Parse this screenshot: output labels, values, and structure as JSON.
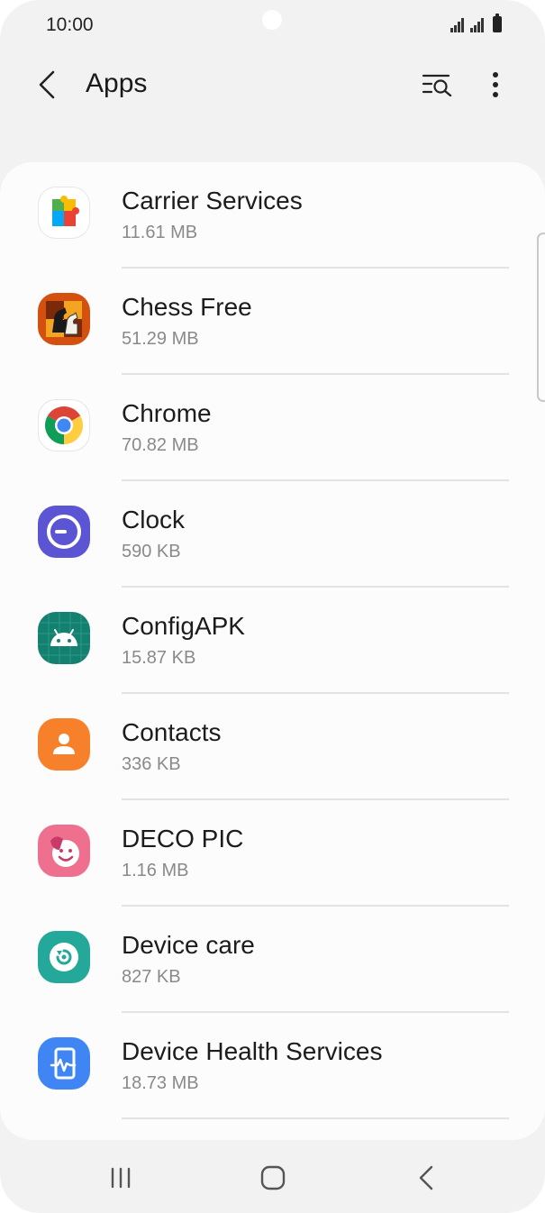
{
  "status_bar": {
    "time": "10:00"
  },
  "header": {
    "title": "Apps"
  },
  "apps": [
    {
      "name": "Carrier Services",
      "size": "11.61 MB",
      "icon": "carrier-services-icon"
    },
    {
      "name": "Chess Free",
      "size": "51.29 MB",
      "icon": "chess-free-icon"
    },
    {
      "name": "Chrome",
      "size": "70.82 MB",
      "icon": "chrome-icon"
    },
    {
      "name": "Clock",
      "size": "590 KB",
      "icon": "clock-icon"
    },
    {
      "name": "ConfigAPK",
      "size": "15.87 KB",
      "icon": "android-icon"
    },
    {
      "name": "Contacts",
      "size": "336 KB",
      "icon": "contacts-icon"
    },
    {
      "name": "DECO PIC",
      "size": "1.16 MB",
      "icon": "deco-pic-icon"
    },
    {
      "name": "Device care",
      "size": "827 KB",
      "icon": "device-care-icon"
    },
    {
      "name": "Device Health Services",
      "size": "18.73 MB",
      "icon": "device-health-icon"
    }
  ],
  "colors": {
    "background": "#f2f2f2",
    "card": "#fcfcfc",
    "clock_purple": "#5b55d3",
    "config_teal": "#14806f",
    "contacts_orange": "#f7812b",
    "deco_pink": "#ef6f8e",
    "device_care_teal": "#23a89a",
    "device_health_blue": "#3f86f4"
  }
}
